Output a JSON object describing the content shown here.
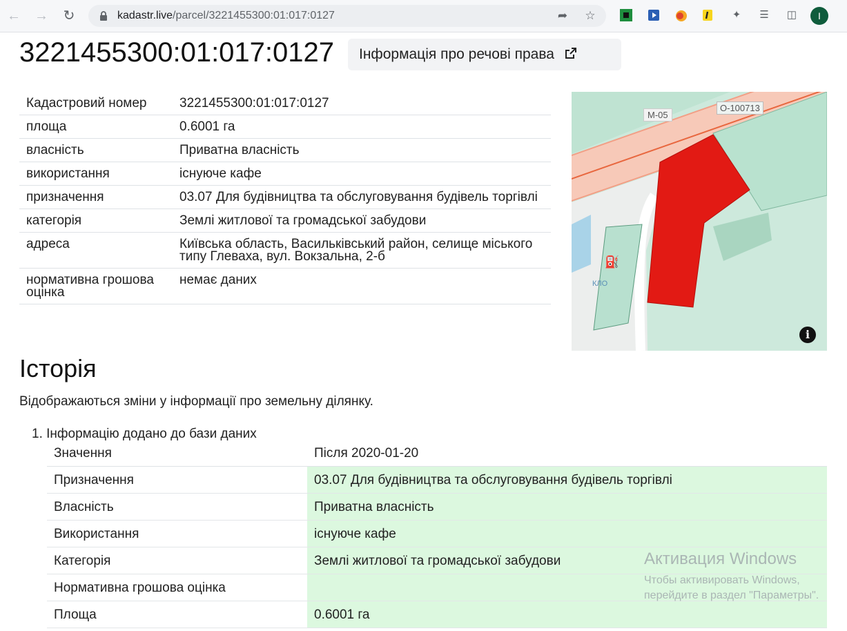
{
  "browser": {
    "url_host": "kadastr.live",
    "url_path": "/parcel/3221455300:01:017:0127",
    "avatar_letter": "I"
  },
  "page": {
    "title": "3221455300:01:017:0127",
    "rights_button": "Інформація про речові права"
  },
  "info_rows": [
    {
      "label": "Кадастровий номер",
      "value": "3221455300:01:017:0127"
    },
    {
      "label": "площа",
      "value": "0.6001 га"
    },
    {
      "label": "власність",
      "value": "Приватна власність"
    },
    {
      "label": "використання",
      "value": "існуюче кафе"
    },
    {
      "label": "призначення",
      "value": "03.07 Для будівництва та обслуговування будівель торгівлі"
    },
    {
      "label": "категорія",
      "value": "Землі житлової та громадської забудови"
    },
    {
      "label": "адреса",
      "value": "Київська область, Васильківський район, селище міського типу Глеваха, вул. Вокзальна, 2-б"
    },
    {
      "label": "нормативна грошова оцінка",
      "value": "немає даних"
    }
  ],
  "map": {
    "road_label": "М-05",
    "plot_label": "О-100713",
    "station_label": "КЛО",
    "parcel_color": "#e21a14"
  },
  "history": {
    "heading": "Історія",
    "description": "Відображаються зміни у інформації про земельну ділянку.",
    "entry_title": "Інформацію додано до бази даних",
    "col_label": "Значення",
    "col_after": "Після 2020-01-20",
    "rows": [
      {
        "label": "Призначення",
        "value": "03.07 Для будівництва та обслуговування будівель торгівлі"
      },
      {
        "label": "Власність",
        "value": "Приватна власність"
      },
      {
        "label": "Використання",
        "value": "існуюче кафе"
      },
      {
        "label": "Категорія",
        "value": "Землі житлової та громадської забудови"
      },
      {
        "label": "Нормативна грошова оцінка",
        "value": ""
      },
      {
        "label": "Площа",
        "value": "0.6001 га"
      }
    ]
  },
  "watermark": {
    "line1": "Активация Windows",
    "line2": "Чтобы активировать Windows,",
    "line3": "перейдите в раздел \"Параметры\"."
  }
}
